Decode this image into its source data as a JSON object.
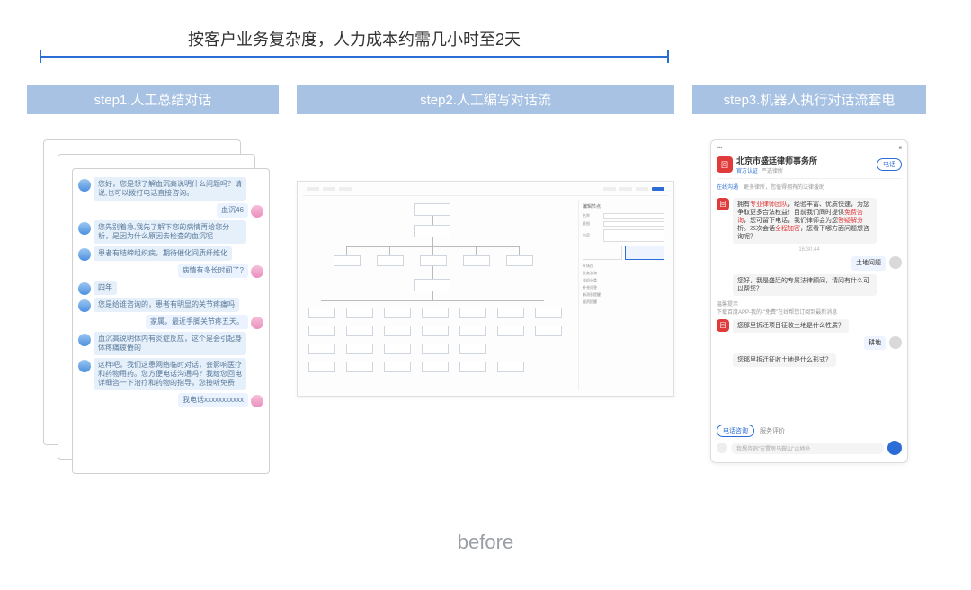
{
  "timeline": {
    "label": "按客户业务复杂度，人力成本约需几小时至2天"
  },
  "steps": {
    "s1": {
      "title": "step1.人工总结对话"
    },
    "s2": {
      "title": "step2.人工编写对话流"
    },
    "s3": {
      "title": "step3.机器人执行对话流套电"
    }
  },
  "chat": {
    "messages": [
      {
        "side": "l",
        "text": "您好，您是想了解血沉高说明什么问题吗？请说,也可以拨打电话直接咨询。"
      },
      {
        "side": "r",
        "text": "血沉46"
      },
      {
        "side": "l",
        "text": "您先别着急,我先了解下您的病情再给您分析，是因为什么原因去检查的血沉呢"
      },
      {
        "side": "l",
        "text": "患者有结缔组织病，期待催化间质纤维化"
      },
      {
        "side": "r",
        "text": "病情有多长时间了?"
      },
      {
        "side": "l",
        "text": "四年"
      },
      {
        "side": "l",
        "text": "您是给谁咨询的，患者有明显的关节疼痛吗"
      },
      {
        "side": "r",
        "text": "家属，最近手脚关节疼五天。"
      },
      {
        "side": "l",
        "text": "血沉高说明体内有炎症反应，这个是会引起身体疼痛疲倦的"
      },
      {
        "side": "l",
        "text": "这样吧，我们这患网络临时对话，会影响医疗和药物用药。您方便电话沟通吗？我给您回电详细咨一下治疗和药物的指导，您接听免费"
      },
      {
        "side": "r",
        "text": "我电话xxxxxxxxxxx"
      }
    ]
  },
  "floweditor": {
    "side_title": "编辑节点",
    "side_fields": [
      "名称",
      "意图",
      "内容"
    ],
    "side_rows": [
      "开场白",
      "业务咨询",
      "挂机分类",
      "补充问答",
      "新消息提醒",
      "留资提醒"
    ]
  },
  "phone": {
    "wifi": "•••",
    "battery": "■",
    "org": "北京市盛廷律师事务所",
    "badge1": "官方认证",
    "badge2": "严选律所",
    "call_btn": "电话",
    "tabs": {
      "a": "在线沟通",
      "b": "更多律所，您值得拥有的法律援助"
    },
    "intro": "拥有专业律师团队，经验丰富、优质快速，为您争取更多合法权益！目前我们同时提供免费咨询，您可留下电话，我们律师会为您答疑解分析。本次会话全程加密，您看下哪方面问题想咨询呢？",
    "intro_red1": "专业律师团队",
    "intro_red2": "免费咨询",
    "intro_red3": "答疑解分",
    "intro_red4": "全程加密",
    "date": "16:30:44",
    "user_reply1": "土地问题",
    "bot_reply1": "您好，我是盛廷的专属法律顾问，请问有什么可以帮您？",
    "tip_title": "温馨提示",
    "tip_body": "下载百度APP-我的-\"免费\"在线帮您订阅到最新消息",
    "bot_q": "您那里拆迁项目征收土地是什么性质？",
    "user_reply2": "耕地",
    "bot_reply2": "您那里拆迁征收土地是什么形式？",
    "foot_pill": "电话咨询",
    "foot_txt": "服务评价",
    "input_ph": "我想咨询\"安置房马鞍山\"点地补"
  },
  "bottom": {
    "label": "before"
  }
}
